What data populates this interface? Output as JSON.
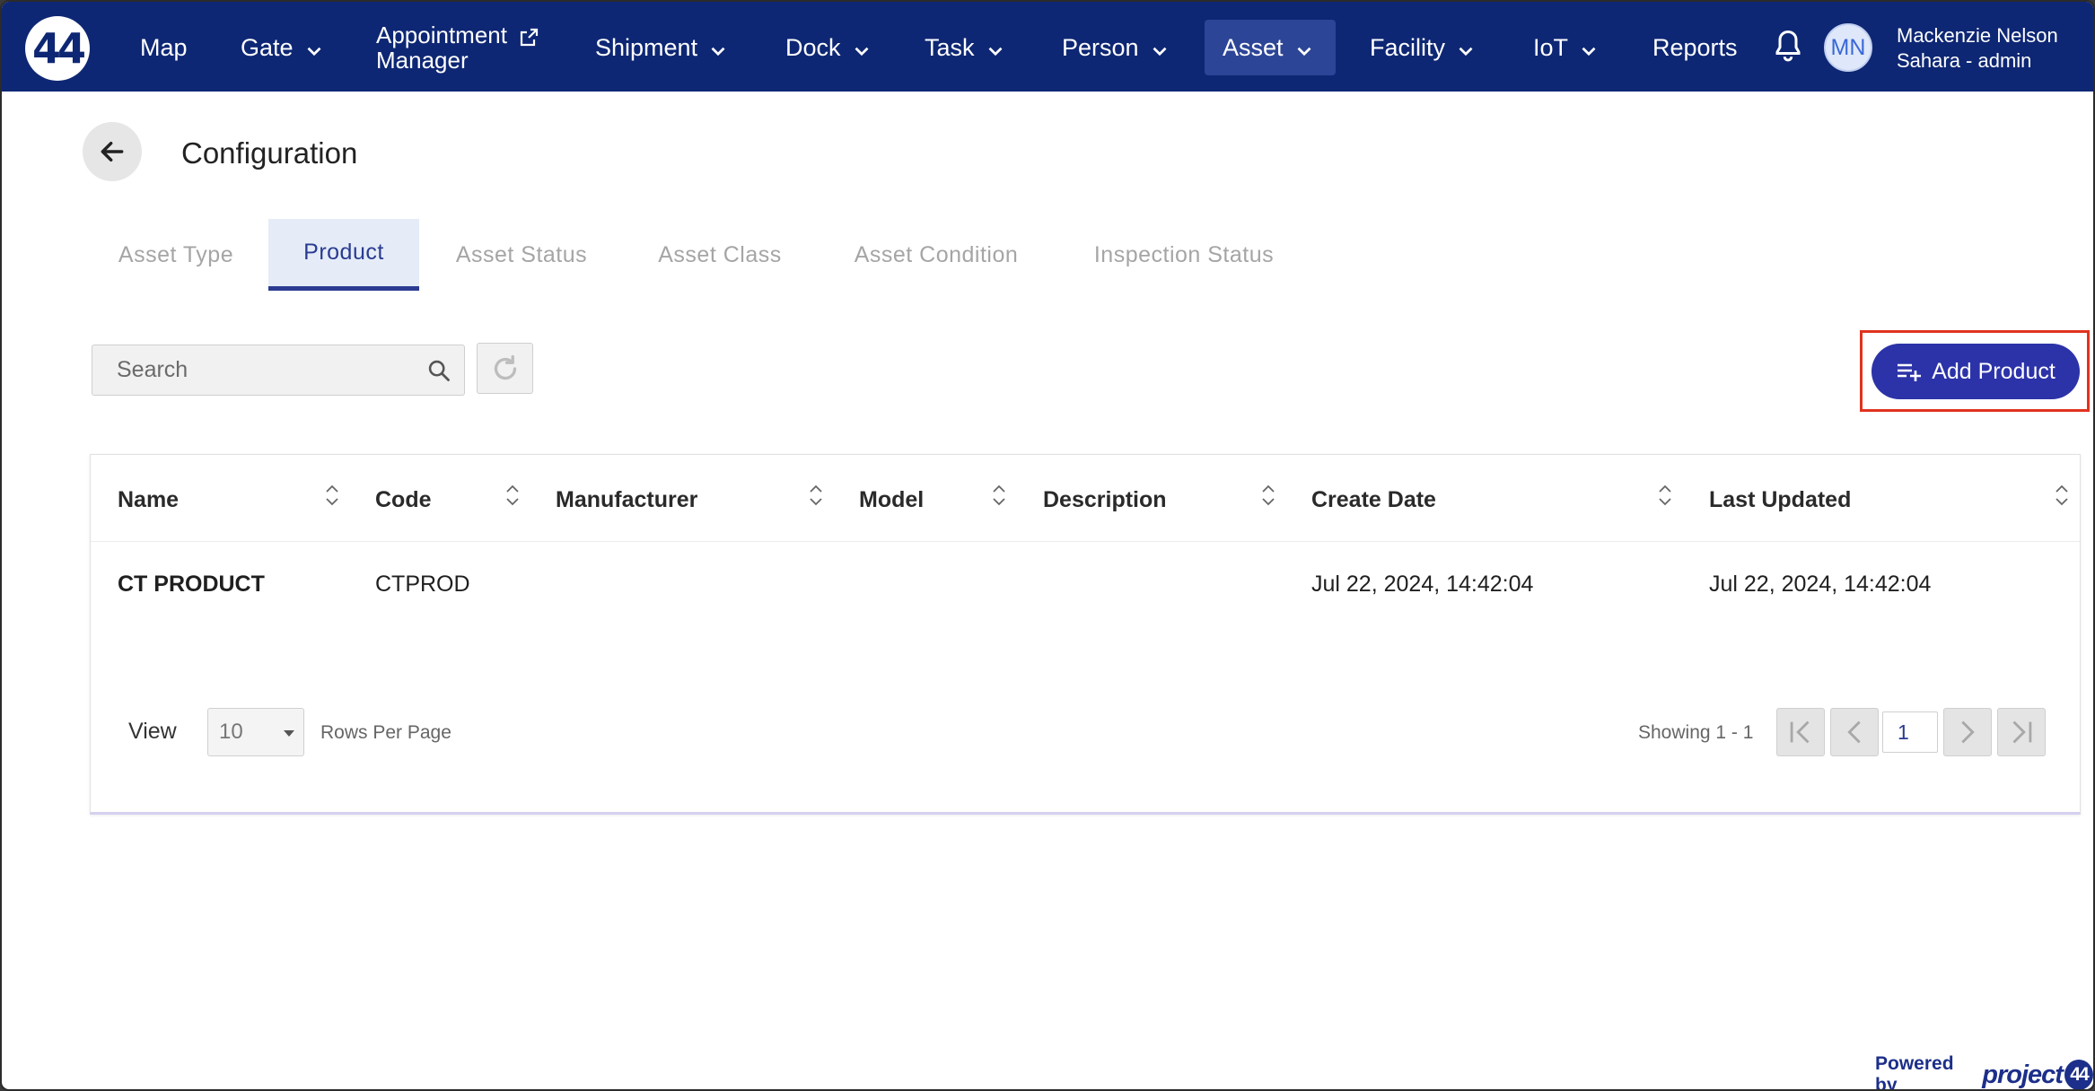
{
  "nav": {
    "logo": "44",
    "items": [
      {
        "label": "Map"
      },
      {
        "label": "Gate"
      },
      {
        "label_line1": "Appointment",
        "label_line2": "Manager"
      },
      {
        "label": "Shipment"
      },
      {
        "label": "Dock"
      },
      {
        "label": "Task"
      },
      {
        "label": "Person"
      },
      {
        "label": "Asset"
      },
      {
        "label": "Facility"
      },
      {
        "label": "IoT"
      },
      {
        "label": "Reports"
      }
    ],
    "active": "Asset",
    "user_initials": "MN",
    "user_name": "Mackenzie Nelson",
    "user_org": "Sahara - admin"
  },
  "page": {
    "title": "Configuration"
  },
  "tabs": [
    {
      "label": "Asset Type"
    },
    {
      "label": "Product"
    },
    {
      "label": "Asset Status"
    },
    {
      "label": "Asset Class"
    },
    {
      "label": "Asset Condition"
    },
    {
      "label": "Inspection Status"
    }
  ],
  "active_tab": "Product",
  "search": {
    "placeholder": "Search",
    "value": ""
  },
  "add_button_label": "Add Product",
  "table": {
    "columns": [
      "Name",
      "Code",
      "Manufacturer",
      "Model",
      "Description",
      "Create Date",
      "Last Updated"
    ],
    "rows": [
      {
        "name": "CT PRODUCT",
        "code": "CTPROD",
        "manufacturer": "",
        "model": "",
        "description": "",
        "create_date": "Jul 22, 2024, 14:42:04",
        "last_updated": "Jul 22, 2024, 14:42:04"
      }
    ]
  },
  "pagination": {
    "view_label": "View",
    "rows_per_page_value": "10",
    "rows_per_page_label": "Rows Per Page",
    "showing": "Showing 1 - 1",
    "current_page": "1"
  },
  "footer": {
    "powered_by": "Powered by",
    "brand": "project",
    "brand_badge": "44"
  },
  "colors": {
    "nav_bg": "#0e2774",
    "accent": "#2c33a8",
    "highlight": "#e0331f"
  }
}
